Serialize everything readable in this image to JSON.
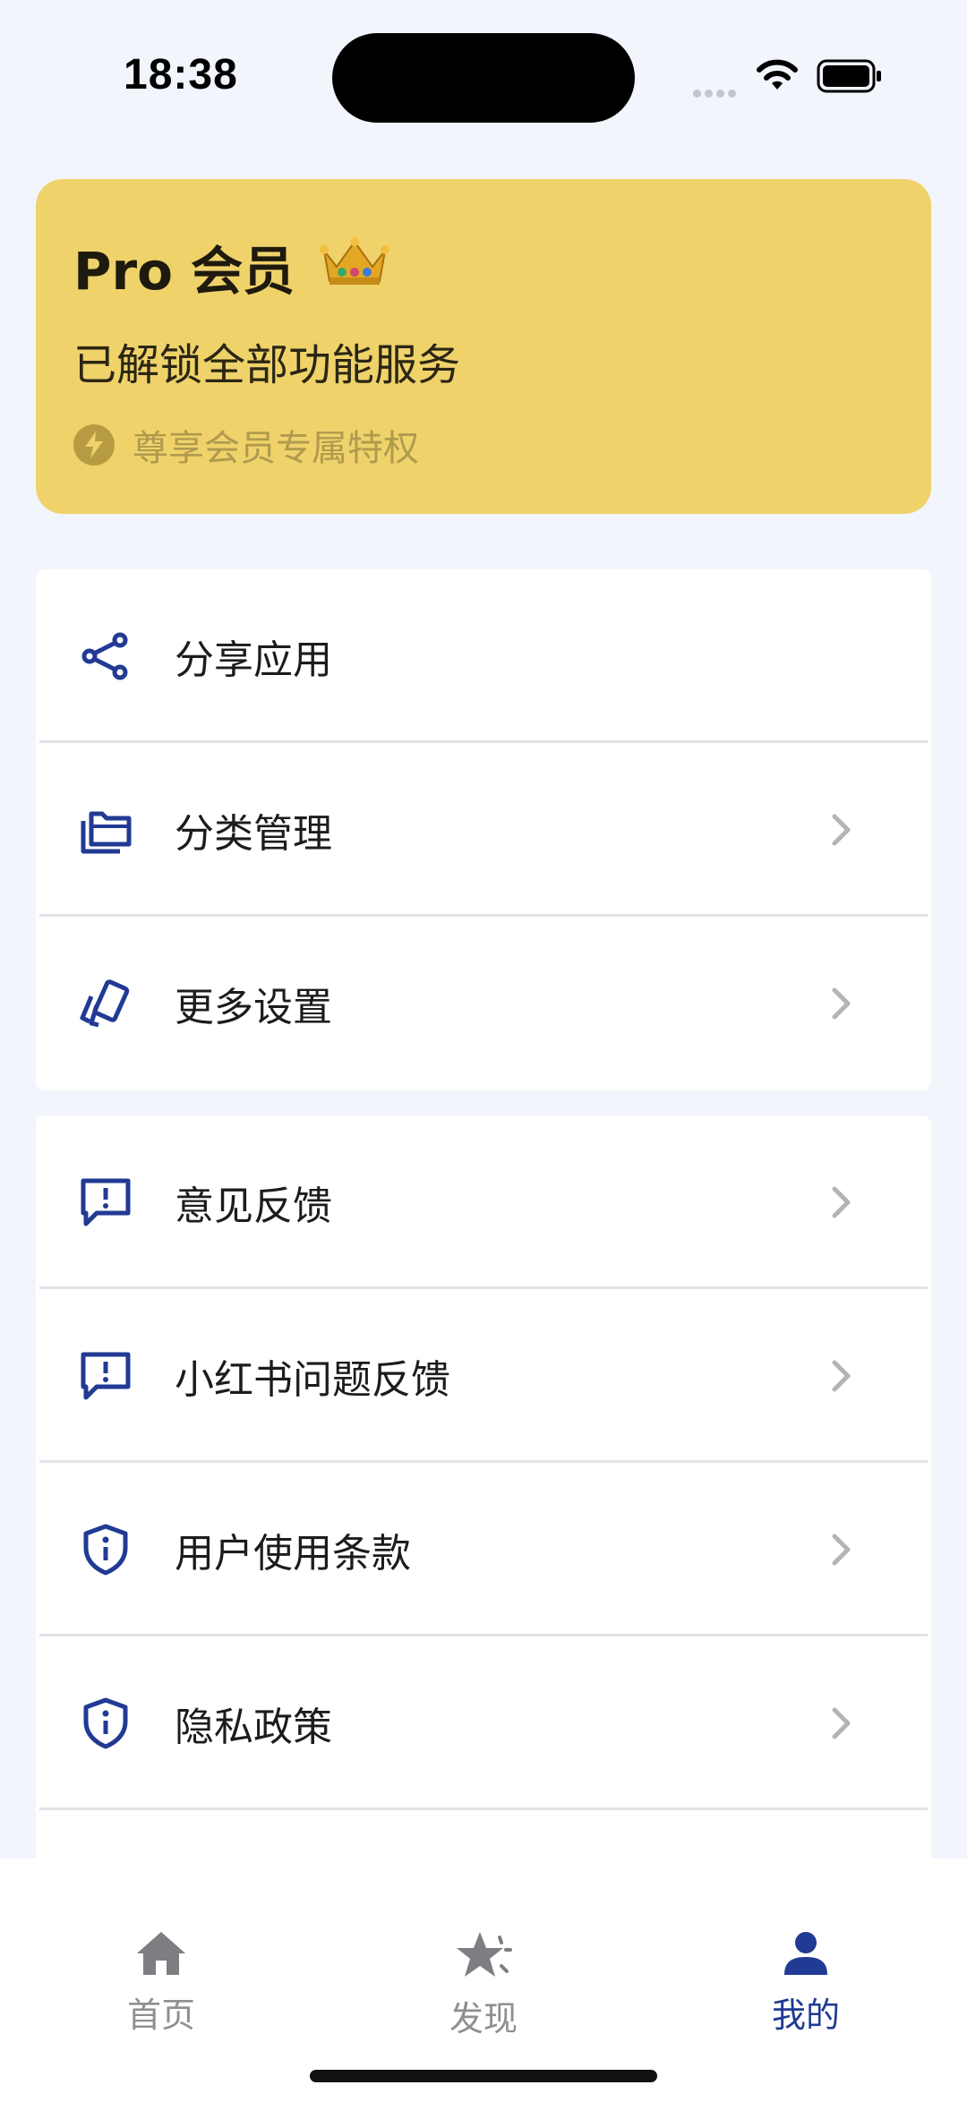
{
  "status_bar": {
    "time": "18:38",
    "icons": [
      "signal-dots-icon",
      "wifi-icon",
      "battery-icon"
    ]
  },
  "pro_card": {
    "title": "Pro 会员",
    "crown_icon": "crown-icon",
    "subtitle": "已解锁全部功能服务",
    "note": "尊享会员专属特权",
    "note_icon": "bolt-icon",
    "background": "#efd26a"
  },
  "section1": {
    "items": [
      {
        "label": "分享应用",
        "icon": "share-icon",
        "chevron": false
      },
      {
        "label": "分类管理",
        "icon": "folder-icon",
        "chevron": true
      },
      {
        "label": "更多设置",
        "icon": "cards-icon",
        "chevron": true
      }
    ]
  },
  "section2": {
    "items": [
      {
        "label": "意见反馈",
        "icon": "feedback-icon",
        "chevron": true
      },
      {
        "label": "小红书问题反馈",
        "icon": "feedback-icon",
        "chevron": true
      },
      {
        "label": "用户使用条款",
        "icon": "shield-info-icon",
        "chevron": true
      },
      {
        "label": "隐私政策",
        "icon": "shield-info-icon",
        "chevron": true
      }
    ]
  },
  "tabbar": {
    "tabs": [
      {
        "label": "首页",
        "icon": "home-icon",
        "active": false
      },
      {
        "label": "发现",
        "icon": "star-icon",
        "active": false
      },
      {
        "label": "我的",
        "icon": "person-icon",
        "active": true
      }
    ]
  },
  "colors": {
    "accent": "#213a94",
    "page_background": "#f2f5fc",
    "inactive": "#8e8e93"
  }
}
